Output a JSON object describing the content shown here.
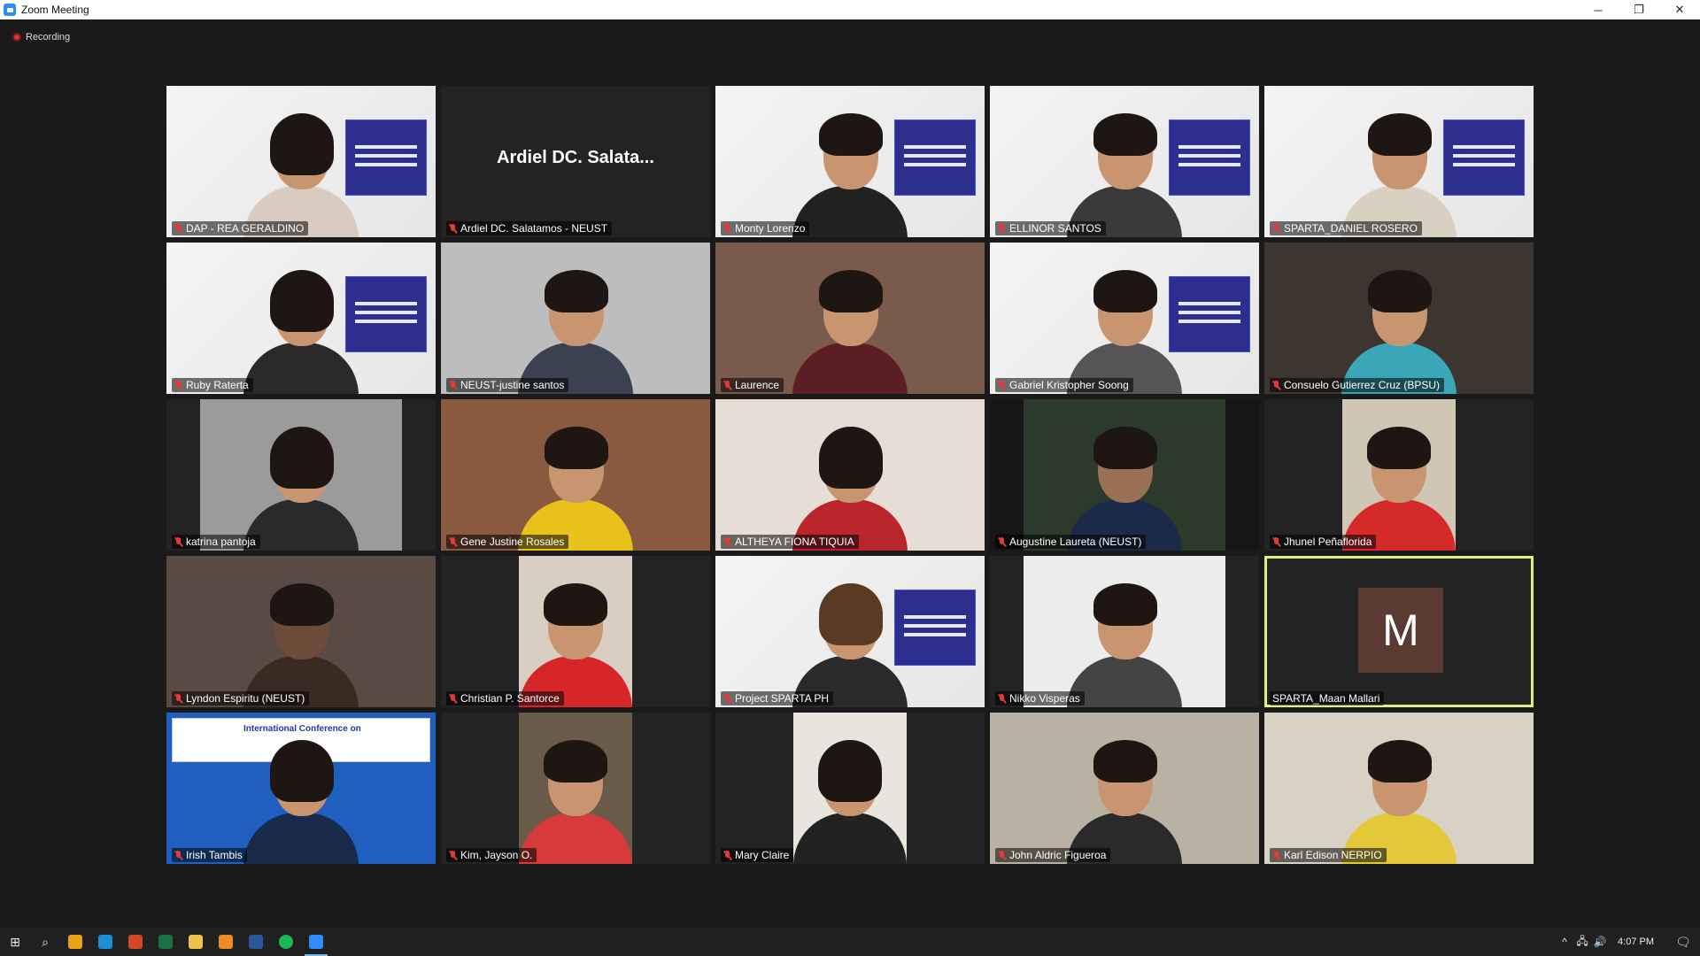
{
  "window": {
    "title": "Zoom Meeting",
    "minimize": "─",
    "restore": "❐",
    "close": "✕"
  },
  "recording": {
    "label": "Recording"
  },
  "participants": [
    {
      "name": "DAP - REA GERALDINO",
      "muted": true
    },
    {
      "name": "Ardiel DC. Salatamos - NEUST",
      "display_name": "Ardiel DC. Salata...",
      "muted": true
    },
    {
      "name": "Monty Lorenzo",
      "muted": true
    },
    {
      "name": "ELLINOR SANTOS",
      "muted": true
    },
    {
      "name": "SPARTA_DANIEL ROSERO",
      "muted": true
    },
    {
      "name": "Ruby Raterta",
      "muted": true
    },
    {
      "name": "NEUST-justine santos",
      "muted": true
    },
    {
      "name": "Laurence",
      "muted": true
    },
    {
      "name": "Gabriel Kristopher Soong",
      "muted": true
    },
    {
      "name": "Consuelo Gutierrez Cruz (BPSU)",
      "muted": true
    },
    {
      "name": "katrina pantoja",
      "muted": true
    },
    {
      "name": "Gene Justine Rosales",
      "muted": true
    },
    {
      "name": "ALTHEYA FIONA TIQUIA",
      "muted": true
    },
    {
      "name": "Augustine Laureta (NEUST)",
      "muted": true
    },
    {
      "name": "Jhunel Peñaflorida",
      "muted": true
    },
    {
      "name": "Lyndon Espiritu (NEUST)",
      "muted": true
    },
    {
      "name": "Christian P. Santorce",
      "muted": true
    },
    {
      "name": "Project SPARTA PH",
      "muted": true
    },
    {
      "name": "Nikko Visperas",
      "muted": true
    },
    {
      "name": "SPARTA_Maan Mallari",
      "avatar_letter": "M",
      "muted": false,
      "active_speaker": true
    },
    {
      "name": "Irish Tambis",
      "muted": true,
      "banner": "International Conference on"
    },
    {
      "name": "Kim, Jayson O.",
      "muted": true
    },
    {
      "name": "Mary Claire",
      "muted": true
    },
    {
      "name": "John Aldric Figueroa",
      "muted": true
    },
    {
      "name": "Karl Edison NERPIO",
      "muted": true
    }
  ],
  "taskbar": {
    "start": "⊞",
    "search": "⌕",
    "apps": [
      "chrome-icon",
      "edge-icon",
      "powerpoint-icon",
      "excel-icon",
      "file-explorer-icon",
      "sublime-icon",
      "word-icon",
      "spotify-icon",
      "zoom-icon"
    ],
    "app_colors": [
      "#e8a313",
      "#1e8fd6",
      "#d24726",
      "#1d7044",
      "#f0c24a",
      "#f08a24",
      "#2b579a",
      "#1db954",
      "#2d8cff"
    ],
    "tray": {
      "chevron": "^",
      "network": "🖧",
      "volume": "🔊",
      "time": "4:07 PM",
      "notifications": "🗨"
    }
  }
}
